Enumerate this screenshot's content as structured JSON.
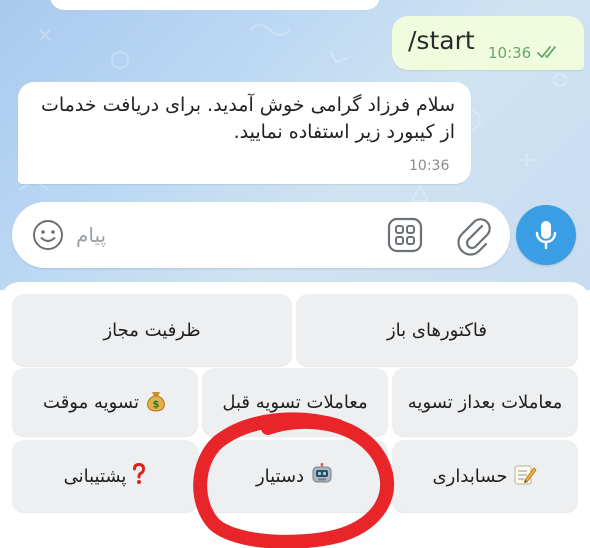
{
  "chat": {
    "outgoing": {
      "text": "/start",
      "time": "10:36"
    },
    "incoming": {
      "text": "سلام فرزاد گرامی خوش آمدید. برای دریافت خدمات از کیبورد زیر استفاده نمایید.",
      "time": "10:36"
    }
  },
  "composer": {
    "placeholder": "پیام"
  },
  "keyboard": {
    "rows": [
      [
        {
          "label": "فاکتورهای باز",
          "icon": null
        },
        {
          "label": "ظرفیت مجاز",
          "icon": null
        }
      ],
      [
        {
          "label": "معاملات بعداز تسویه",
          "icon": null
        },
        {
          "label": "معاملات تسویه قبل",
          "icon": null
        },
        {
          "label": "تسویه موقت",
          "icon": "money-bag-icon"
        }
      ],
      [
        {
          "label": "حسابداری",
          "icon": "memo-icon"
        },
        {
          "label": "دستیار",
          "icon": "robot-icon"
        },
        {
          "label": "پشتیبانی",
          "icon": "question-mark-icon"
        }
      ]
    ]
  },
  "colors": {
    "outgoing_bubble": "#effdde",
    "mic_button": "#3a9ee4",
    "keyboard_button": "#edeff1",
    "annotation_circle": "#e8262a"
  }
}
